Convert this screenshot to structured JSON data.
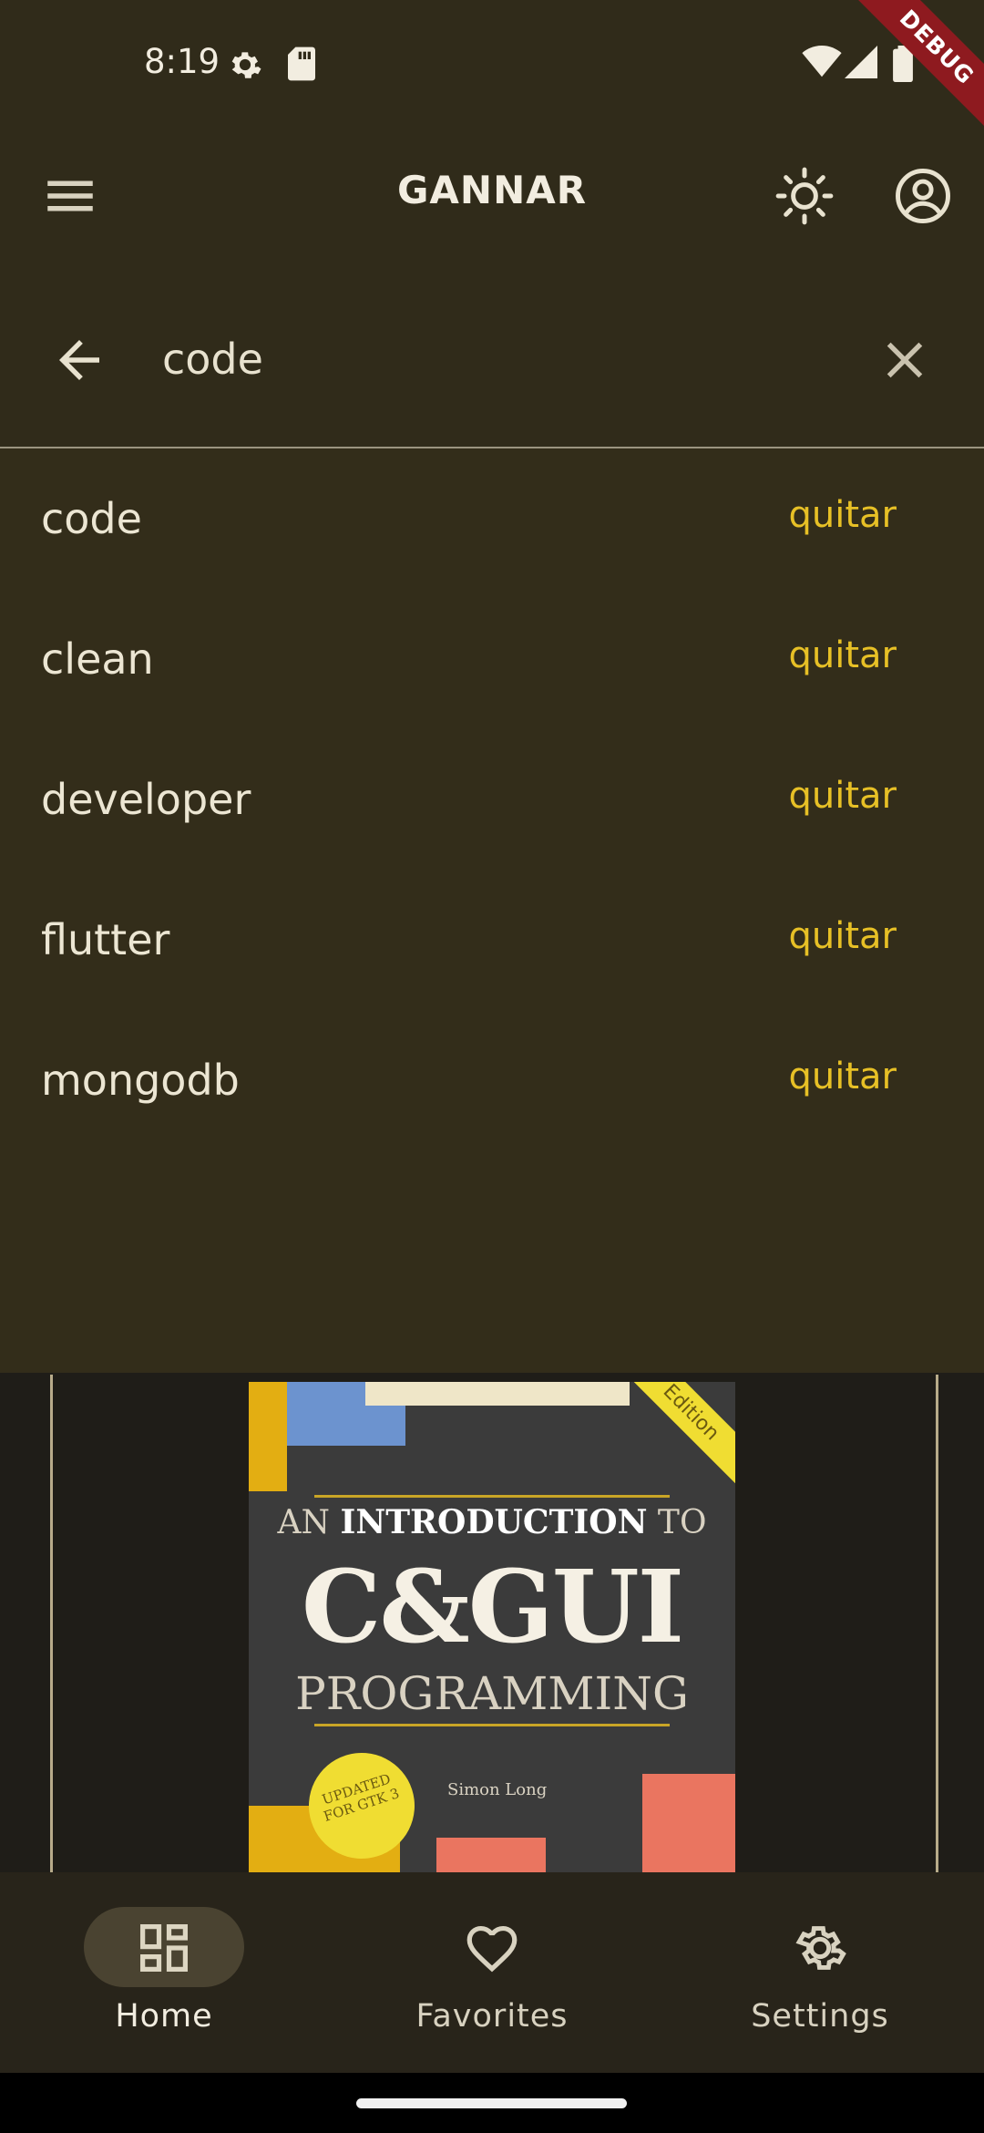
{
  "status_bar": {
    "time": "8:19",
    "icons": [
      "settings-gear-icon",
      "sd-card-icon",
      "wifi-icon",
      "cell-signal-icon",
      "battery-icon"
    ]
  },
  "debug_banner": "DEBUG",
  "app_bar": {
    "title": "GANNAR",
    "menu_icon": "menu-icon",
    "theme_icon": "sun-icon",
    "account_icon": "account-circle-icon"
  },
  "search": {
    "value": "code",
    "back_icon": "arrow-back-icon",
    "clear_icon": "close-icon"
  },
  "results": [
    {
      "term": "code",
      "tag": "quitar"
    },
    {
      "term": "clean",
      "tag": "quitar"
    },
    {
      "term": "developer",
      "tag": "quitar"
    },
    {
      "term": "flutter",
      "tag": "quitar"
    },
    {
      "term": "mongodb",
      "tag": "quitar"
    }
  ],
  "book_cover": {
    "line1_prefix": "AN ",
    "line1_bold": "INTRODUCTION",
    "line1_suffix": " TO",
    "line2": "C&GUI",
    "line3": "PROGRAMMING",
    "author": "Simon Long",
    "seal": "UPDATED FOR GTK 3",
    "edition": "Edition"
  },
  "bottom_nav": [
    {
      "label": "Home",
      "icon": "dashboard-icon",
      "active": true
    },
    {
      "label": "Favorites",
      "icon": "heart-icon",
      "active": false
    },
    {
      "label": "Settings",
      "icon": "gear-icon",
      "active": false
    }
  ],
  "colors": {
    "background": "#302b1a",
    "accent_tag": "#e7c026",
    "nav_background": "#28241a",
    "debug": "#8e1a1f"
  }
}
